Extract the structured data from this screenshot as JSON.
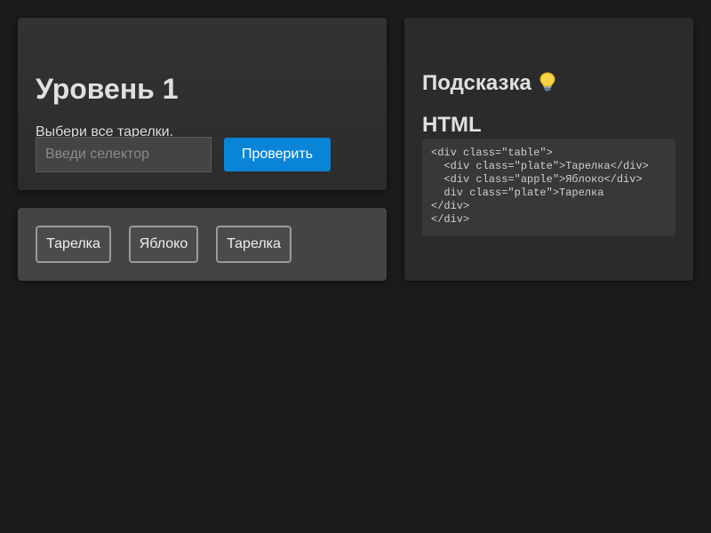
{
  "level": {
    "title": "Уровень 1",
    "task": "Выбери все тарелки.",
    "input_placeholder": "Введи селектор",
    "input_value": "",
    "check_button": "Проверить"
  },
  "table": {
    "items": [
      {
        "label": "Тарелка"
      },
      {
        "label": "Яблоко"
      },
      {
        "label": "Тарелка"
      }
    ]
  },
  "hint": {
    "title": "Подсказка",
    "icon": "lightbulb-icon",
    "html_heading": "HTML",
    "code_lines": [
      "<div class=\"table\">",
      "  <div class=\"plate\">Тарелка</div>",
      "  <div class=\"apple\">Яблоко</div>",
      "  div class=\"plate\">Тарелка",
      "</div>",
      "</div>"
    ]
  },
  "colors": {
    "background": "#1b1b1b",
    "card": "#2d2d2d",
    "accent_button": "#0a84d6",
    "item_border": "#9a9a9a"
  }
}
